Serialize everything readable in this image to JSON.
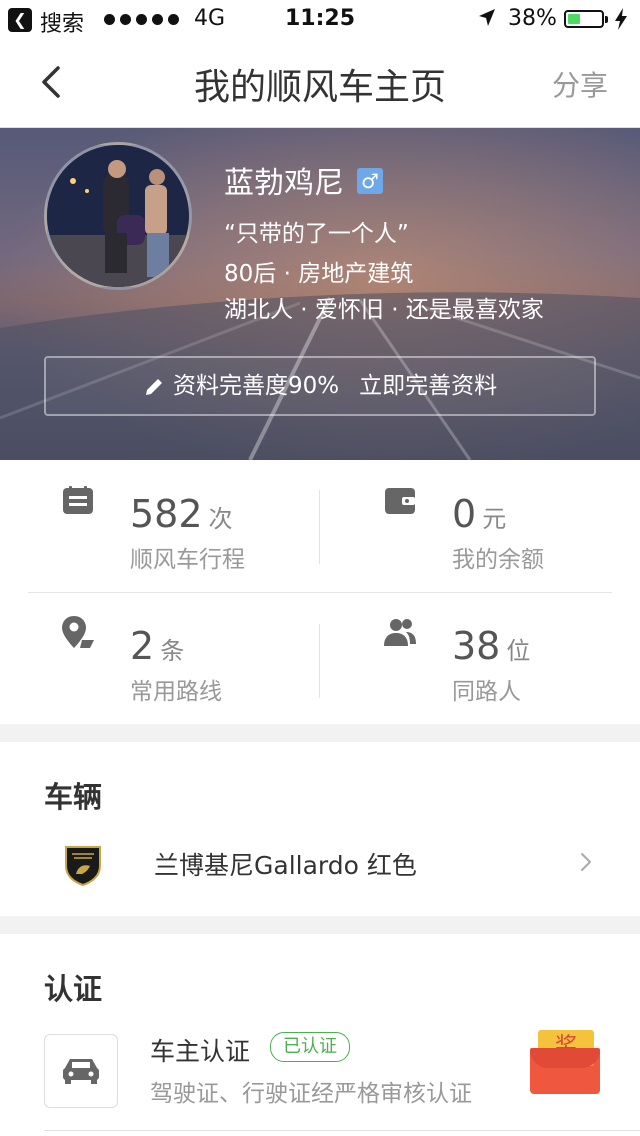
{
  "status_bar": {
    "back_app": "搜索",
    "network": "4G",
    "time": "11:25",
    "battery": "38%",
    "battery_level": 0.38,
    "signal_icon": "signal-dots-icon",
    "location_icon": "location-arrow-icon",
    "charging_icon": "charging-bolt-icon"
  },
  "nav": {
    "title": "我的顺风车主页",
    "share_label": "分享",
    "back_icon": "back-chevron-icon"
  },
  "profile": {
    "name": "蓝勃鸡尼",
    "gender_symbol": "♂",
    "quote": "“只带的了一个人”",
    "info_line1": "80后 · 房地产建筑",
    "info_line2": "湖北人 · 爱怀旧 · 还是最喜欢家",
    "completion_text": "资料完善度90%",
    "completion_action": "立即完善资料"
  },
  "stats": [
    {
      "value": "582",
      "unit": "次",
      "label": "顺风车行程",
      "icon": "trip-list-icon"
    },
    {
      "value": "0",
      "unit": "元",
      "label": "我的余额",
      "icon": "wallet-icon"
    },
    {
      "value": "2",
      "unit": "条",
      "label": "常用路线",
      "icon": "route-pin-icon"
    },
    {
      "value": "38",
      "unit": "位",
      "label": "同路人",
      "icon": "people-icon"
    }
  ],
  "vehicle": {
    "section_title": "车辆",
    "car_name": "兰博基尼Gallardo 红色",
    "logo_icon": "lamborghini-logo-icon"
  },
  "certification": {
    "section_title": "认证",
    "title": "车主认证",
    "badge": "已认证",
    "description": "驾驶证、行驶证经严格审核认证",
    "reward_label": "奖"
  },
  "colors": {
    "accent_green": "#4caf50",
    "gender_blue": "#6fa8e8",
    "reward_red": "#f0573f",
    "reward_gold": "#f5c33b"
  }
}
